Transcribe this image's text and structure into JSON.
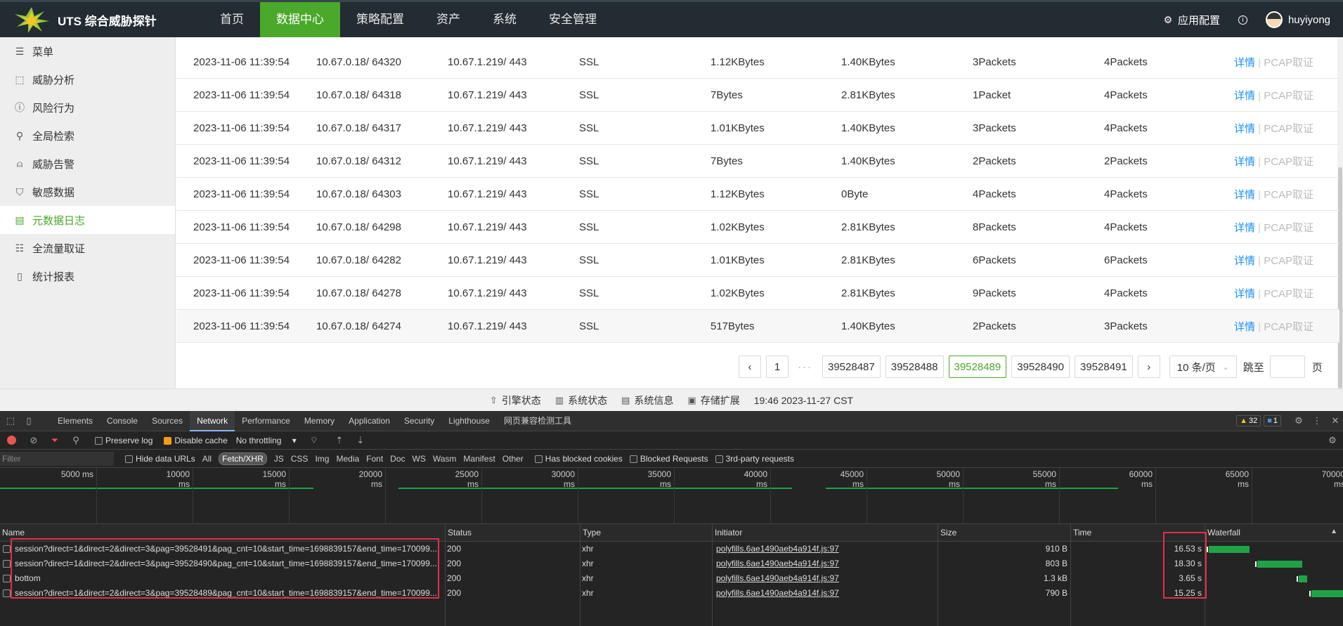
{
  "topbar": {
    "logo_text": "UTS 综合威胁探针",
    "nav": [
      "首页",
      "数据中心",
      "策略配置",
      "资产",
      "系统",
      "安全管理"
    ],
    "active_nav": 1,
    "app_config": "应用配置",
    "info_icon": "info-icon",
    "username": "huyiyong"
  },
  "sidebar": {
    "items": [
      {
        "label": "菜单",
        "icon": "menu-icon"
      },
      {
        "label": "威胁分析",
        "icon": "chart-icon"
      },
      {
        "label": "风险行为",
        "icon": "alert-circle-icon"
      },
      {
        "label": "全局检索",
        "icon": "search-icon"
      },
      {
        "label": "威胁告警",
        "icon": "siren-icon"
      },
      {
        "label": "敏感数据",
        "icon": "shield-icon"
      },
      {
        "label": "元数据日志",
        "icon": "log-icon"
      },
      {
        "label": "全流量取证",
        "icon": "database-icon"
      },
      {
        "label": "统计报表",
        "icon": "report-icon"
      }
    ],
    "active_index": 6
  },
  "table": {
    "rows": [
      {
        "time": "2023-11-06 11:39:54",
        "src": "10.67.0.18/ 64320",
        "dst": "10.67.1.219/ 443",
        "proto": "SSL",
        "up": "1.12KBytes",
        "down": "1.40KBytes",
        "up_pkts": "3Packets",
        "down_pkts": "4Packets"
      },
      {
        "time": "2023-11-06 11:39:54",
        "src": "10.67.0.18/ 64318",
        "dst": "10.67.1.219/ 443",
        "proto": "SSL",
        "up": "7Bytes",
        "down": "2.81KBytes",
        "up_pkts": "1Packet",
        "down_pkts": "4Packets"
      },
      {
        "time": "2023-11-06 11:39:54",
        "src": "10.67.0.18/ 64317",
        "dst": "10.67.1.219/ 443",
        "proto": "SSL",
        "up": "1.01KBytes",
        "down": "1.40KBytes",
        "up_pkts": "3Packets",
        "down_pkts": "4Packets"
      },
      {
        "time": "2023-11-06 11:39:54",
        "src": "10.67.0.18/ 64312",
        "dst": "10.67.1.219/ 443",
        "proto": "SSL",
        "up": "7Bytes",
        "down": "1.40KBytes",
        "up_pkts": "2Packets",
        "down_pkts": "2Packets"
      },
      {
        "time": "2023-11-06 11:39:54",
        "src": "10.67.0.18/ 64303",
        "dst": "10.67.1.219/ 443",
        "proto": "SSL",
        "up": "1.12KBytes",
        "down": "0Byte",
        "up_pkts": "4Packets",
        "down_pkts": "4Packets"
      },
      {
        "time": "2023-11-06 11:39:54",
        "src": "10.67.0.18/ 64298",
        "dst": "10.67.1.219/ 443",
        "proto": "SSL",
        "up": "1.02KBytes",
        "down": "2.81KBytes",
        "up_pkts": "8Packets",
        "down_pkts": "4Packets"
      },
      {
        "time": "2023-11-06 11:39:54",
        "src": "10.67.0.18/ 64282",
        "dst": "10.67.1.219/ 443",
        "proto": "SSL",
        "up": "1.01KBytes",
        "down": "2.81KBytes",
        "up_pkts": "6Packets",
        "down_pkts": "6Packets"
      },
      {
        "time": "2023-11-06 11:39:54",
        "src": "10.67.0.18/ 64278",
        "dst": "10.67.1.219/ 443",
        "proto": "SSL",
        "up": "1.02KBytes",
        "down": "2.81KBytes",
        "up_pkts": "9Packets",
        "down_pkts": "4Packets"
      },
      {
        "time": "2023-11-06 11:39:54",
        "src": "10.67.0.18/ 64274",
        "dst": "10.67.1.219/ 443",
        "proto": "SSL",
        "up": "517Bytes",
        "down": "1.40KBytes",
        "up_pkts": "2Packets",
        "down_pkts": "3Packets"
      }
    ],
    "detail_label": "详情",
    "pcap_label": "PCAP取证"
  },
  "pager": {
    "first": "1",
    "ellipsis": "···",
    "pages": [
      "39528487",
      "39528488",
      "39528489",
      "39528490",
      "39528491"
    ],
    "active_page": "39528489",
    "page_size": "10 条/页",
    "jump_label": "跳至",
    "page_suffix": "页"
  },
  "statusbar": {
    "items": [
      "引擎状态",
      "系统状态",
      "系统信息",
      "存储扩展"
    ],
    "clock": "19:46 2023-11-27 CST"
  },
  "devtools": {
    "tabs": [
      "Elements",
      "Console",
      "Sources",
      "Network",
      "Performance",
      "Memory",
      "Application",
      "Security",
      "Lighthouse",
      "网页兼容检测工具"
    ],
    "active_tab": "Network",
    "warnings": "32",
    "messages": "1",
    "preserve_log": "Preserve log",
    "disable_cache": "Disable cache",
    "throttling": "No throttling",
    "filter_placeholder": "Filter",
    "hide_data_urls": "Hide data URLs",
    "filter_types": [
      "All",
      "Fetch/XHR",
      "JS",
      "CSS",
      "Img",
      "Media",
      "Font",
      "Doc",
      "WS",
      "Wasm",
      "Manifest",
      "Other"
    ],
    "selected_type": "Fetch/XHR",
    "has_blocked_cookies": "Has blocked cookies",
    "blocked_requests": "Blocked Requests",
    "third_party": "3rd-party requests",
    "timeline_ticks": [
      "5000 ms",
      "10000 ms",
      "15000 ms",
      "20000 ms",
      "25000 ms",
      "30000 ms",
      "35000 ms",
      "40000 ms",
      "45000 ms",
      "50000 ms",
      "55000 ms",
      "60000 ms",
      "65000 ms",
      "70000 ms"
    ],
    "columns": [
      "Name",
      "Status",
      "Type",
      "Initiator",
      "Size",
      "Time",
      "Waterfall"
    ],
    "requests": [
      {
        "name": "session?direct=1&direct=2&direct=3&pag=39528491&pag_cnt=10&start_time=1698839157&end_time=170099...",
        "status": "200",
        "type": "xhr",
        "initiator": "polyfills.6ae1490aeb4a914f.js:97",
        "size": "910 B",
        "time": "16.53 s"
      },
      {
        "name": "session?direct=1&direct=2&direct=3&pag=39528490&pag_cnt=10&start_time=1698839157&end_time=170099...",
        "status": "200",
        "type": "xhr",
        "initiator": "polyfills.6ae1490aeb4a914f.js:97",
        "size": "803 B",
        "time": "18.30 s"
      },
      {
        "name": "bottom",
        "status": "200",
        "type": "xhr",
        "initiator": "polyfills.6ae1490aeb4a914f.js:97",
        "size": "1.3 kB",
        "time": "3.65 s"
      },
      {
        "name": "session?direct=1&direct=2&direct=3&pag=39528489&pag_cnt=10&start_time=1698839157&end_time=170099...",
        "status": "200",
        "type": "xhr",
        "initiator": "polyfills.6ae1490aeb4a914f.js:97",
        "size": "790 B",
        "time": "15.25 s"
      }
    ]
  },
  "colors": {
    "accent_green": "#4aa82a",
    "link_blue": "#1890ff",
    "topbar_bg": "#232b33",
    "highlight_red": "#e0304a"
  }
}
